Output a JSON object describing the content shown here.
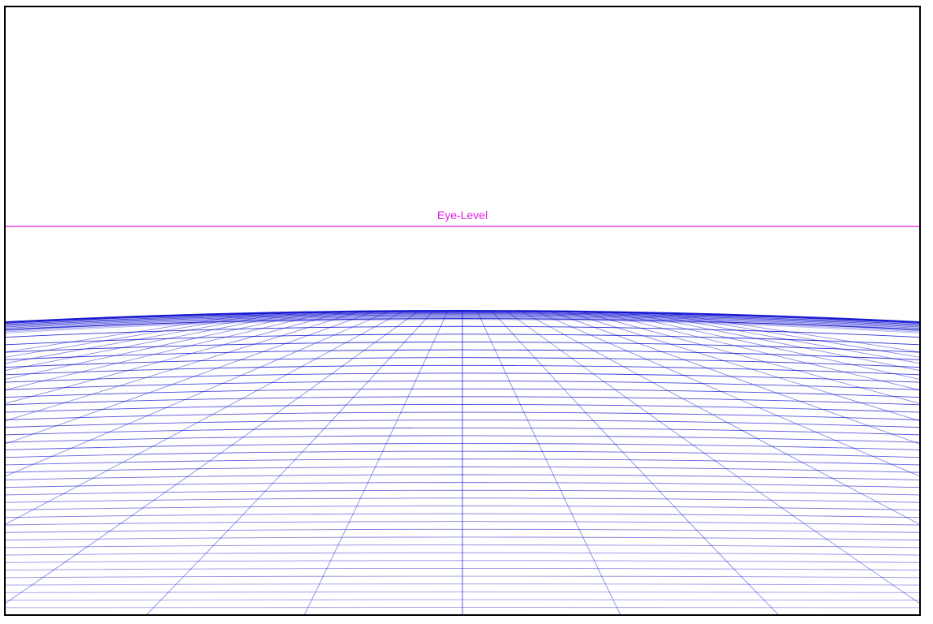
{
  "eye_level": {
    "label": "Eye-Level",
    "color": "#e020e0"
  },
  "grid": {
    "color": "#0000cc"
  },
  "frame": {
    "border_color": "#000000",
    "background": "#ffffff"
  }
}
